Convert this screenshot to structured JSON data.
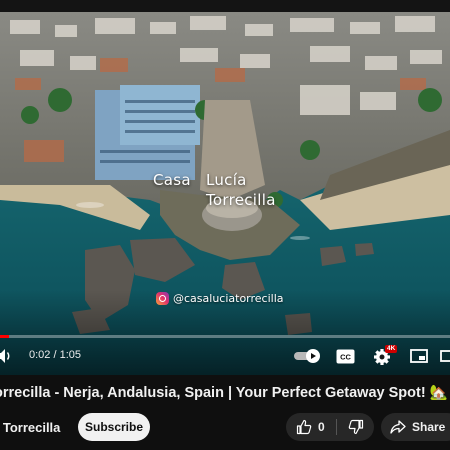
{
  "video": {
    "overlay_name_line1": "Casa Lucía",
    "overlay_name_line2": "Torrecilla",
    "instagram_handle": "@casaluciatorrecilla",
    "progress_fraction": 0.019
  },
  "player_controls": {
    "current_time": "0:02",
    "separator": " / ",
    "duration": "1:05",
    "quality_badge": "4K"
  },
  "meta": {
    "title": "orrecilla - Nerja, Andalusia, Spain | Your Perfect Getaway Spot! 🏡",
    "channel_name": "a Torrecilla",
    "subscribe_label": "Subscribe",
    "like_count": "0",
    "share_label": "Share"
  },
  "colors": {
    "background": "#0f0f0f",
    "progress": "#ff0000",
    "button_dark": "#272727",
    "subscribe_bg": "#f1f1f1"
  }
}
